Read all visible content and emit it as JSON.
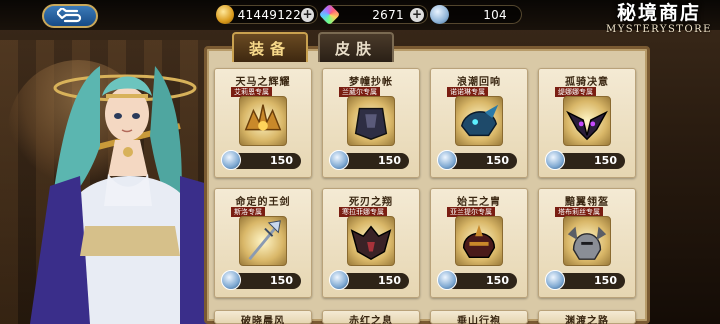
{
  "topbar": {
    "gold": "41449122",
    "gems": "2671",
    "tickets": "104",
    "plus_symbol": "+",
    "back_icon": "back-arrow-icon"
  },
  "store": {
    "title_cn": "秘境商店",
    "title_en": "MYSTERYSTORE"
  },
  "tabs": [
    {
      "label": "装备",
      "active": true
    },
    {
      "label": "皮肤",
      "active": false
    }
  ],
  "items": [
    {
      "name": "天马之辉耀",
      "tag": "艾莉恩专属",
      "price": "150",
      "icon": "golden-crest-icon"
    },
    {
      "name": "梦幢抄帐",
      "tag": "兰葳尔专属",
      "price": "150",
      "icon": "dark-armor-icon"
    },
    {
      "name": "浪潮回响",
      "tag": "诺诺琳专属",
      "price": "150",
      "icon": "dragon-helm-icon"
    },
    {
      "name": "孤骑决意",
      "tag": "缇娜娜专属",
      "price": "150",
      "icon": "winged-mask-icon"
    },
    {
      "name": "命定的王剑",
      "tag": "斯洛专属",
      "price": "150",
      "icon": "trident-icon"
    },
    {
      "name": "死刃之翔",
      "tag": "寒拉菲娜专属",
      "price": "150",
      "icon": "bat-armor-icon"
    },
    {
      "name": "始王之胄",
      "tag": "亚兰提尔专属",
      "price": "150",
      "icon": "crimson-helm-icon"
    },
    {
      "name": "黯翼翎盔",
      "tag": "塔布莉丝专属",
      "price": "150",
      "icon": "silver-helm-icon"
    },
    {
      "name": "破晓晨风",
      "tag": "",
      "price": "",
      "icon": ""
    },
    {
      "name": "赤红之息",
      "tag": "",
      "price": "",
      "icon": ""
    },
    {
      "name": "垂山行袍",
      "tag": "",
      "price": "",
      "icon": ""
    },
    {
      "name": "渊渡之路",
      "tag": "",
      "price": "",
      "icon": ""
    }
  ]
}
